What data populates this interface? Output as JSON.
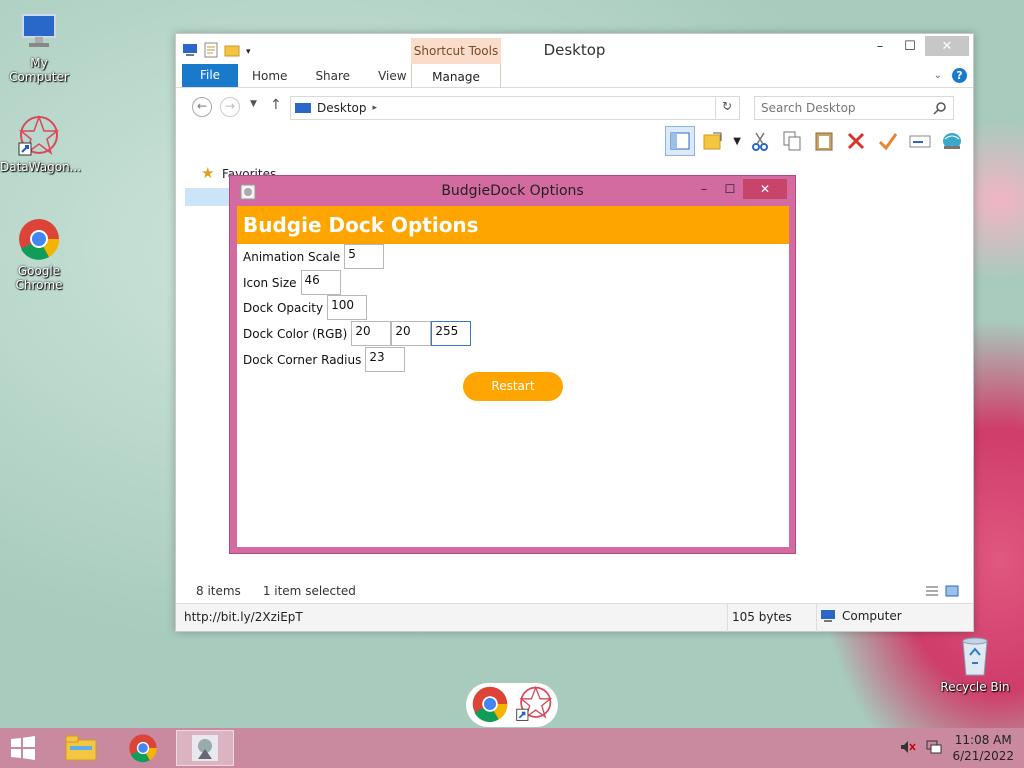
{
  "desktop": {
    "icons": [
      {
        "label": "My Computer"
      },
      {
        "label": "DataWagon..."
      },
      {
        "label": "Google Chrome"
      },
      {
        "label": "Recycle Bin"
      }
    ]
  },
  "explorer": {
    "title": "Desktop",
    "shortcut_tools": "Shortcut Tools",
    "tabs": {
      "file": "File",
      "home": "Home",
      "share": "Share",
      "view": "View",
      "manage": "Manage"
    },
    "address": "Desktop",
    "search_placeholder": "Search Desktop",
    "nav": {
      "favorites": "Favorites"
    },
    "status": {
      "items": "8 items",
      "selected": "1 item selected"
    },
    "bottom": {
      "url": "http://bit.ly/2XziEpT",
      "size": "105 bytes",
      "location": "Computer"
    }
  },
  "dialog": {
    "title": "BudgieDock Options",
    "header": "Budgie Dock Options",
    "fields": {
      "animation_scale": {
        "label": "Animation Scale",
        "value": "5"
      },
      "icon_size": {
        "label": "Icon Size",
        "value": "46"
      },
      "dock_opacity": {
        "label": "Dock Opacity",
        "value": "100"
      },
      "dock_color": {
        "label": "Dock Color (RGB)",
        "r": "20",
        "g": "20",
        "b": "255"
      },
      "corner_radius": {
        "label": "Dock Corner Radius",
        "value": "23"
      }
    },
    "restart_label": "Restart"
  },
  "taskbar": {
    "time": "11:08 AM",
    "date": "6/21/2022"
  },
  "colors": {
    "accent_orange": "#ffa500",
    "dialog_frame": "#d36aa0",
    "ribbon_file": "#1979ca",
    "taskbar": "#c98aa0"
  }
}
